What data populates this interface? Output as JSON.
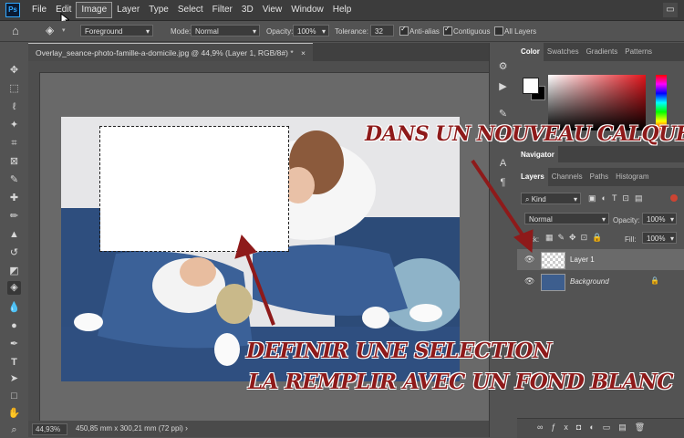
{
  "menubar": {
    "logo": "Ps",
    "items": [
      "File",
      "Edit",
      "Image",
      "Layer",
      "Type",
      "Select",
      "Filter",
      "3D",
      "View",
      "Window",
      "Help"
    ],
    "active_item": "Image"
  },
  "options": {
    "fill_source": "Foreground",
    "mode_label": "Mode:",
    "mode_value": "Normal",
    "opacity_label": "Opacity:",
    "opacity_value": "100%",
    "tolerance_label": "Tolerance:",
    "tolerance_value": "32",
    "anti_alias_label": "Anti-alias",
    "anti_alias_checked": true,
    "contiguous_label": "Contiguous",
    "contiguous_checked": true,
    "all_layers_label": "All Layers",
    "all_layers_checked": false
  },
  "document": {
    "tab_title": "Overlay_seance-photo-famille-a-domicile.jpg @ 44,9% (Layer 1, RGB/8#) *",
    "zoom": "44,93%",
    "dimensions": "450,85 mm x 300,21 mm (72 ppi)"
  },
  "panels": {
    "color_tabs": [
      "Color",
      "Swatches",
      "Gradients",
      "Patterns"
    ],
    "navigator_tab": "Navigator",
    "layer_tabs": [
      "Layers",
      "Channels",
      "Paths",
      "Histogram"
    ],
    "kind_value": "Kind",
    "blend_value": "Normal",
    "opacity_label": "Opacity:",
    "opacity_value": "100%",
    "lock_label": "Lock:",
    "fill_label": "Fill:",
    "fill_value": "100%",
    "layers": [
      {
        "name": "Layer 1",
        "selected": true
      },
      {
        "name": "Background",
        "selected": false
      }
    ]
  },
  "annotations": {
    "top": "DANS UN NOUVEAU CALQUE",
    "bottom_line1": "DEFINIR UNE SELECTION",
    "bottom_line2": "LA REMPLIR AVEC UN FOND BLANC",
    "arrow_color": "#8e1a1a"
  },
  "colors": {
    "foreground": "#ffffff",
    "background": "#000000",
    "picker_hue": "#e0141b"
  }
}
